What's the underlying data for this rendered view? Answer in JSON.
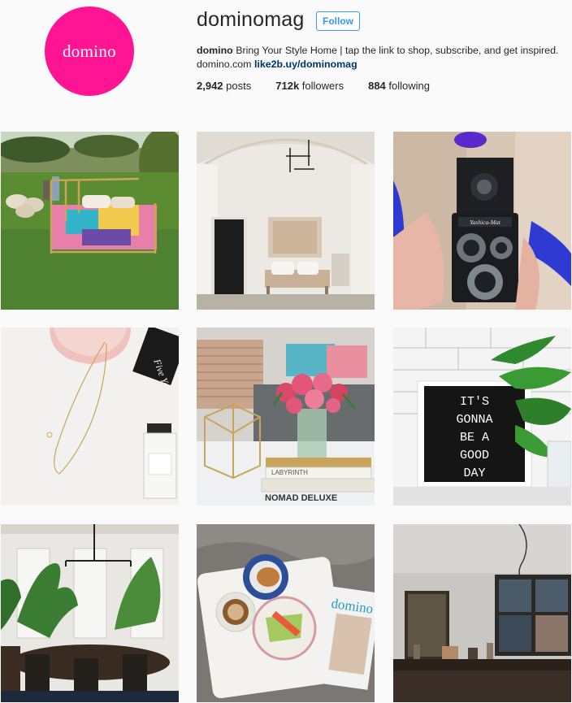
{
  "profile": {
    "avatar_text": "domino",
    "username": "dominomag",
    "follow_label": "Follow",
    "bio_name": "domino",
    "bio_text": "Bring Your Style Home | tap the link to shop, subscribe, and get inspired.",
    "bio_site": "domino.com",
    "bio_link": "like2b.uy/dominomag",
    "stats": {
      "posts_count": "2,942",
      "posts_label": "posts",
      "followers_count": "712k",
      "followers_label": "followers",
      "following_count": "884",
      "following_label": "following"
    }
  },
  "posts": [
    {
      "description": "bed in sheep pasture"
    },
    {
      "description": "white arched room with bench"
    },
    {
      "description": "hands holding yashica camera"
    },
    {
      "description": "gold necklace and pink tray"
    },
    {
      "description": "pink flowers on coffee table"
    },
    {
      "description": "letter board with plant"
    },
    {
      "description": "dining room with plants"
    },
    {
      "description": "breakfast tray with magazine"
    },
    {
      "description": "kitchen with pendant lamp"
    }
  ],
  "post_text": {
    "camera_brand": "Yashica-Mat",
    "letterboard_lines": [
      "IT'S",
      "GONNA",
      "BE A",
      "GOOD",
      "DAY"
    ],
    "book_title": "NOMAD DELUXE",
    "book_title_2": "LABYRINTH",
    "notebook_text": "Five Year",
    "magazine_title": "domino"
  }
}
